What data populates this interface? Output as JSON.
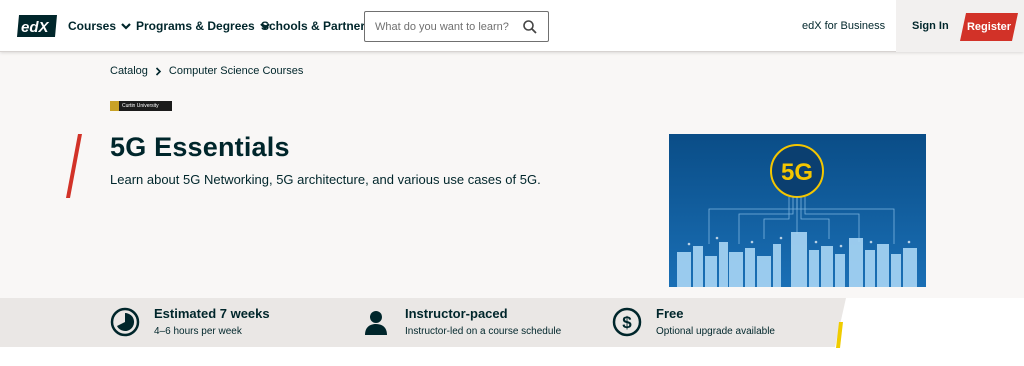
{
  "header": {
    "logo_text": "edX",
    "nav": [
      {
        "label": "Courses"
      },
      {
        "label": "Programs & Degrees"
      },
      {
        "label": "Schools & Partners"
      }
    ],
    "search_placeholder": "What do you want to learn?",
    "business_label": "edX for Business",
    "signin_label": "Sign In",
    "register_label": "Register",
    "brand_color": "#d23228"
  },
  "breadcrumb": {
    "items": [
      "Catalog",
      "Computer Science Courses"
    ]
  },
  "course": {
    "partner": "Curtin University",
    "title": "5G Essentials",
    "subtitle": "Learn about 5G Networking, 5G architecture, and various use cases of 5G.",
    "image_label": "5G"
  },
  "info": [
    {
      "icon": "clock-icon",
      "title": "Estimated 7 weeks",
      "detail": "4–6 hours per week"
    },
    {
      "icon": "person-icon",
      "title": "Instructor-paced",
      "detail": "Instructor-led on a course schedule"
    },
    {
      "icon": "dollar-icon",
      "title": "Free",
      "detail": "Optional upgrade available"
    }
  ]
}
